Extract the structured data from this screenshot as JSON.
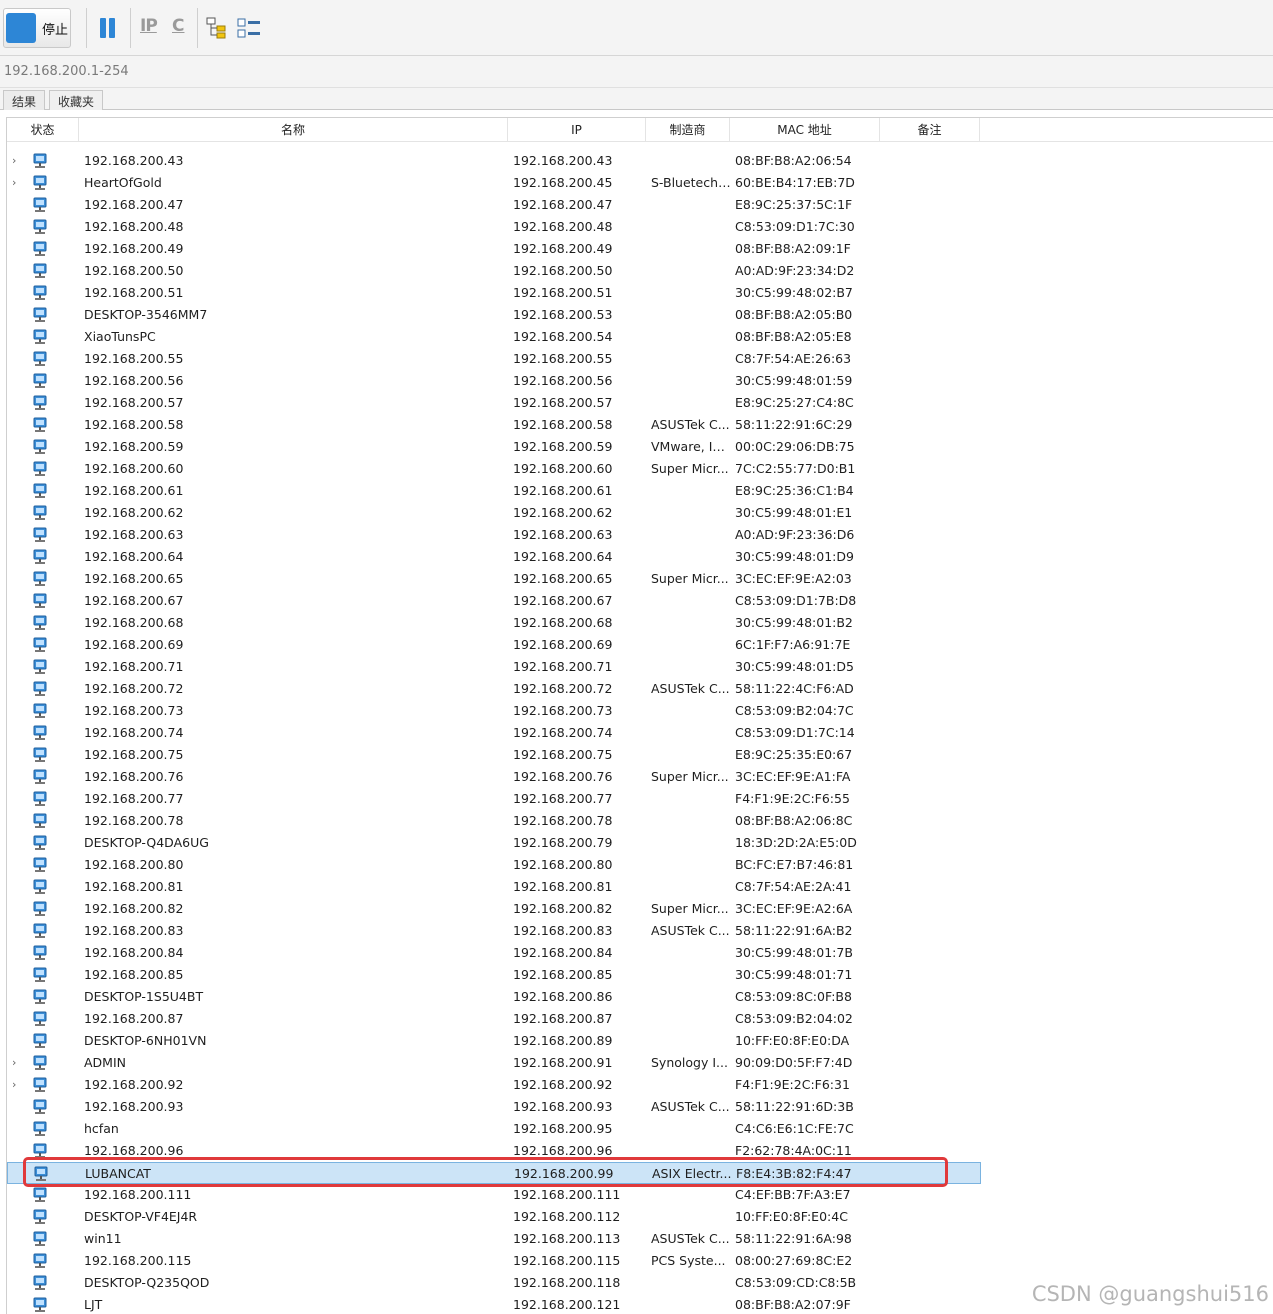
{
  "toolbar": {
    "stop_label": "停止",
    "pause_icon": "pause-icon",
    "ip_icon_label": "IP",
    "c_icon_label": "C",
    "colors": {
      "accent": "#2d86d6",
      "icon_gray": "#9a9a9a"
    }
  },
  "address": {
    "range": "192.168.200.1-254"
  },
  "tabs": [
    {
      "label": "结果"
    },
    {
      "label": "收藏夹"
    }
  ],
  "columns": {
    "status": "状态",
    "name": "名称",
    "ip": "IP",
    "vendor": "制造商",
    "mac": "MAC 地址",
    "note": "备注"
  },
  "rows": [
    {
      "name": "192.168.200.43",
      "ip": "192.168.200.43",
      "vendor": "",
      "mac": "08:BF:B8:A2:06:54",
      "expand": true
    },
    {
      "name": "HeartOfGold",
      "ip": "192.168.200.45",
      "vendor": "S-Bluetech ...",
      "mac": "60:BE:B4:17:EB:7D",
      "expand": true
    },
    {
      "name": "192.168.200.47",
      "ip": "192.168.200.47",
      "vendor": "",
      "mac": "E8:9C:25:37:5C:1F"
    },
    {
      "name": "192.168.200.48",
      "ip": "192.168.200.48",
      "vendor": "",
      "mac": "C8:53:09:D1:7C:30"
    },
    {
      "name": "192.168.200.49",
      "ip": "192.168.200.49",
      "vendor": "",
      "mac": "08:BF:B8:A2:09:1F"
    },
    {
      "name": "192.168.200.50",
      "ip": "192.168.200.50",
      "vendor": "",
      "mac": "A0:AD:9F:23:34:D2"
    },
    {
      "name": "192.168.200.51",
      "ip": "192.168.200.51",
      "vendor": "",
      "mac": "30:C5:99:48:02:B7"
    },
    {
      "name": "DESKTOP-3546MM7",
      "ip": "192.168.200.53",
      "vendor": "",
      "mac": "08:BF:B8:A2:05:B0"
    },
    {
      "name": "XiaoTunsPC",
      "ip": "192.168.200.54",
      "vendor": "",
      "mac": "08:BF:B8:A2:05:E8"
    },
    {
      "name": "192.168.200.55",
      "ip": "192.168.200.55",
      "vendor": "",
      "mac": "C8:7F:54:AE:26:63"
    },
    {
      "name": "192.168.200.56",
      "ip": "192.168.200.56",
      "vendor": "",
      "mac": "30:C5:99:48:01:59"
    },
    {
      "name": "192.168.200.57",
      "ip": "192.168.200.57",
      "vendor": "",
      "mac": "E8:9C:25:27:C4:8C"
    },
    {
      "name": "192.168.200.58",
      "ip": "192.168.200.58",
      "vendor": "ASUSTek C...",
      "mac": "58:11:22:91:6C:29"
    },
    {
      "name": "192.168.200.59",
      "ip": "192.168.200.59",
      "vendor": "VMware, Inc.",
      "mac": "00:0C:29:06:DB:75"
    },
    {
      "name": "192.168.200.60",
      "ip": "192.168.200.60",
      "vendor": "Super Micr...",
      "mac": "7C:C2:55:77:D0:B1"
    },
    {
      "name": "192.168.200.61",
      "ip": "192.168.200.61",
      "vendor": "",
      "mac": "E8:9C:25:36:C1:B4"
    },
    {
      "name": "192.168.200.62",
      "ip": "192.168.200.62",
      "vendor": "",
      "mac": "30:C5:99:48:01:E1"
    },
    {
      "name": "192.168.200.63",
      "ip": "192.168.200.63",
      "vendor": "",
      "mac": "A0:AD:9F:23:36:D6"
    },
    {
      "name": "192.168.200.64",
      "ip": "192.168.200.64",
      "vendor": "",
      "mac": "30:C5:99:48:01:D9"
    },
    {
      "name": "192.168.200.65",
      "ip": "192.168.200.65",
      "vendor": "Super Micr...",
      "mac": "3C:EC:EF:9E:A2:03"
    },
    {
      "name": "192.168.200.67",
      "ip": "192.168.200.67",
      "vendor": "",
      "mac": "C8:53:09:D1:7B:D8"
    },
    {
      "name": "192.168.200.68",
      "ip": "192.168.200.68",
      "vendor": "",
      "mac": "30:C5:99:48:01:B2"
    },
    {
      "name": "192.168.200.69",
      "ip": "192.168.200.69",
      "vendor": "",
      "mac": "6C:1F:F7:A6:91:7E"
    },
    {
      "name": "192.168.200.71",
      "ip": "192.168.200.71",
      "vendor": "",
      "mac": "30:C5:99:48:01:D5"
    },
    {
      "name": "192.168.200.72",
      "ip": "192.168.200.72",
      "vendor": "ASUSTek C...",
      "mac": "58:11:22:4C:F6:AD"
    },
    {
      "name": "192.168.200.73",
      "ip": "192.168.200.73",
      "vendor": "",
      "mac": "C8:53:09:B2:04:7C"
    },
    {
      "name": "192.168.200.74",
      "ip": "192.168.200.74",
      "vendor": "",
      "mac": "C8:53:09:D1:7C:14"
    },
    {
      "name": "192.168.200.75",
      "ip": "192.168.200.75",
      "vendor": "",
      "mac": "E8:9C:25:35:E0:67"
    },
    {
      "name": "192.168.200.76",
      "ip": "192.168.200.76",
      "vendor": "Super Micr...",
      "mac": "3C:EC:EF:9E:A1:FA"
    },
    {
      "name": "192.168.200.77",
      "ip": "192.168.200.77",
      "vendor": "",
      "mac": "F4:F1:9E:2C:F6:55"
    },
    {
      "name": "192.168.200.78",
      "ip": "192.168.200.78",
      "vendor": "",
      "mac": "08:BF:B8:A2:06:8C"
    },
    {
      "name": "DESKTOP-Q4DA6UG",
      "ip": "192.168.200.79",
      "vendor": "",
      "mac": "18:3D:2D:2A:E5:0D"
    },
    {
      "name": "192.168.200.80",
      "ip": "192.168.200.80",
      "vendor": "",
      "mac": "BC:FC:E7:B7:46:81"
    },
    {
      "name": "192.168.200.81",
      "ip": "192.168.200.81",
      "vendor": "",
      "mac": "C8:7F:54:AE:2A:41"
    },
    {
      "name": "192.168.200.82",
      "ip": "192.168.200.82",
      "vendor": "Super Micr...",
      "mac": "3C:EC:EF:9E:A2:6A"
    },
    {
      "name": "192.168.200.83",
      "ip": "192.168.200.83",
      "vendor": "ASUSTek C...",
      "mac": "58:11:22:91:6A:B2"
    },
    {
      "name": "192.168.200.84",
      "ip": "192.168.200.84",
      "vendor": "",
      "mac": "30:C5:99:48:01:7B"
    },
    {
      "name": "192.168.200.85",
      "ip": "192.168.200.85",
      "vendor": "",
      "mac": "30:C5:99:48:01:71"
    },
    {
      "name": "DESKTOP-1S5U4BT",
      "ip": "192.168.200.86",
      "vendor": "",
      "mac": "C8:53:09:8C:0F:B8"
    },
    {
      "name": "192.168.200.87",
      "ip": "192.168.200.87",
      "vendor": "",
      "mac": "C8:53:09:B2:04:02"
    },
    {
      "name": "DESKTOP-6NH01VN",
      "ip": "192.168.200.89",
      "vendor": "",
      "mac": "10:FF:E0:8F:E0:DA"
    },
    {
      "name": "ADMIN",
      "ip": "192.168.200.91",
      "vendor": "Synology I...",
      "mac": "90:09:D0:5F:F7:4D",
      "expand": true
    },
    {
      "name": "192.168.200.92",
      "ip": "192.168.200.92",
      "vendor": "",
      "mac": "F4:F1:9E:2C:F6:31",
      "expand": true
    },
    {
      "name": "192.168.200.93",
      "ip": "192.168.200.93",
      "vendor": "ASUSTek C...",
      "mac": "58:11:22:91:6D:3B"
    },
    {
      "name": "hcfan",
      "ip": "192.168.200.95",
      "vendor": "",
      "mac": "C4:C6:E6:1C:FE:7C"
    },
    {
      "name": "192.168.200.96",
      "ip": "192.168.200.96",
      "vendor": "",
      "mac": "F2:62:78:4A:0C:11"
    },
    {
      "name": "LUBANCAT",
      "ip": "192.168.200.99",
      "vendor": "ASIX Electr...",
      "mac": "F8:E4:3B:82:F4:47",
      "selected": true
    },
    {
      "name": "192.168.200.111",
      "ip": "192.168.200.111",
      "vendor": "",
      "mac": "C4:EF:BB:7F:A3:E7"
    },
    {
      "name": "DESKTOP-VF4EJ4R",
      "ip": "192.168.200.112",
      "vendor": "",
      "mac": "10:FF:E0:8F:E0:4C"
    },
    {
      "name": "win11",
      "ip": "192.168.200.113",
      "vendor": "ASUSTek C...",
      "mac": "58:11:22:91:6A:98"
    },
    {
      "name": "192.168.200.115",
      "ip": "192.168.200.115",
      "vendor": "PCS Syste...",
      "mac": "08:00:27:69:8C:E2"
    },
    {
      "name": "DESKTOP-Q235QOD",
      "ip": "192.168.200.118",
      "vendor": "",
      "mac": "C8:53:09:CD:C8:5B"
    },
    {
      "name": "LJT",
      "ip": "192.168.200.121",
      "vendor": "",
      "mac": "08:BF:B8:A2:07:9F"
    }
  ],
  "watermark": "CSDN @guangshui516",
  "highlight_color": "#e0393b",
  "selection_color": "#cce4f7"
}
